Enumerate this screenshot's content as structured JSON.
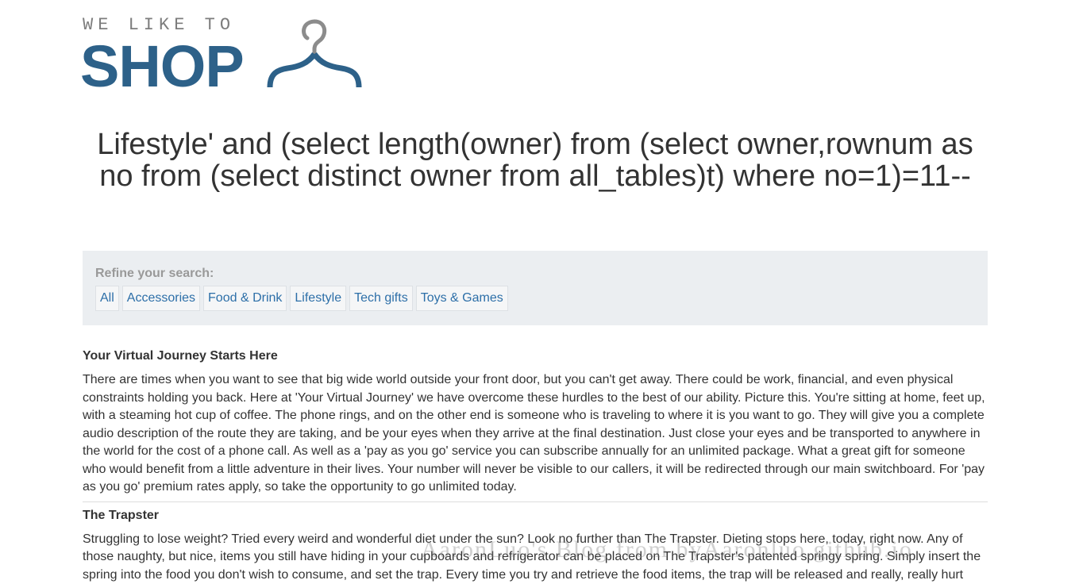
{
  "logo": {
    "small_text": "WE LIKE TO",
    "big_text": "SHOP"
  },
  "page_title": "Lifestyle' and (select length(owner) from (select owner,rownum as no from (select distinct owner from all_tables)t) where no=1)=11--",
  "filters": {
    "label": "Refine your search:",
    "items": [
      {
        "label": "All"
      },
      {
        "label": "Accessories"
      },
      {
        "label": "Food & Drink"
      },
      {
        "label": "Lifestyle"
      },
      {
        "label": "Tech gifts"
      },
      {
        "label": "Toys & Games"
      }
    ]
  },
  "articles": [
    {
      "title": "Your Virtual Journey Starts Here",
      "body": "There are times when you want to see that big wide world outside your front door, but you can't get away. There could be work, financial, and even physical constraints holding you back. Here at 'Your Virtual Journey' we have overcome these hurdles to the best of our ability. Picture this. You're sitting at home, feet up, with a steaming hot cup of coffee. The phone rings, and on the other end is someone who is traveling to where it is you want to go. They will give you a complete audio description of the route they are taking, and be your eyes when they arrive at the final destination. Just close your eyes and be transported to anywhere in the world for the cost of a phone call. As well as a 'pay as you go' service you can subscribe annually for an unlimited package. What a great gift for someone who would benefit from a little adventure in their lives. Your number will never be visible to our callers, it will be redirected through our main switchboard. For 'pay as you go' premium rates apply, so take the opportunity to go unlimited today."
    },
    {
      "title": "The Trapster",
      "body": "Struggling to lose weight? Tried every weird and wonderful diet under the sun? Look no further than The Trapster. Dieting stops here, today, right now. Any of those naughty, but nice, items you still have hiding in your cupboards and refrigerator can be placed on The Trapster's patented springy spring. Simply insert the spring into the food you don't wish to consume, and set the trap. Every time you try and retrieve the food items, the trap will be released and really, really hurt your fingers. The Trapster is remarkably efficient at curbing off-the-cuff snacking cravings. Now you'll think twice!"
    }
  ],
  "watermark": "AaronLuo's Blog from byAaronluo.github.io",
  "colors": {
    "brand_blue": "#2d6189",
    "link_blue": "#2d6fa8",
    "panel_bg": "#ebeef1",
    "hanger_gray": "#8c8c8c"
  }
}
